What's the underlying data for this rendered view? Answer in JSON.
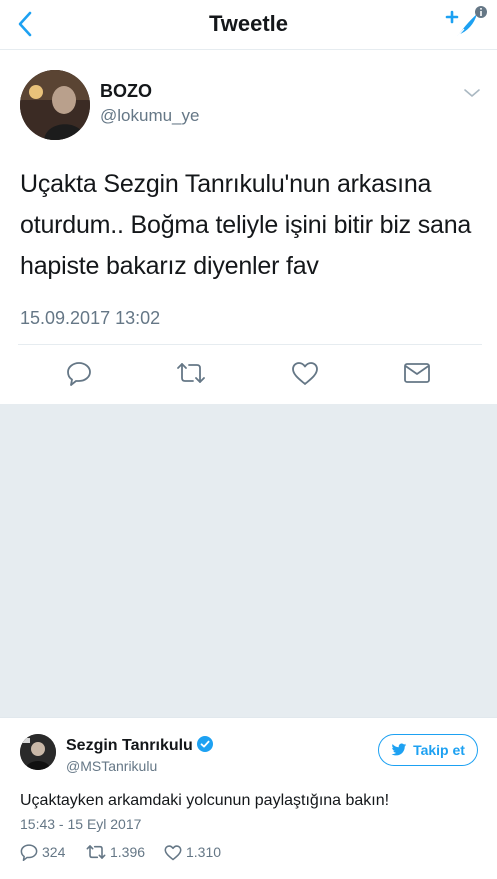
{
  "header": {
    "title": "Tweetle",
    "back_icon": "chevron-left-icon",
    "compose_icon": "compose-feather-icon",
    "accent": "#1da1f2"
  },
  "tweet": {
    "name": "BOZO",
    "handle": "@lokumu_ye",
    "text": "Uçakta Sezgin Tanrıkulu'nun arkasına oturdum.. Boğma teliyle işini bitir biz sana hapiste bakarız diyenler fav",
    "timestamp": "15.09.2017 13:02",
    "actions": [
      "reply-icon",
      "retweet-icon",
      "like-icon",
      "message-icon"
    ]
  },
  "embedded": {
    "name": "Sezgin Tanrıkulu",
    "handle": "@MSTanrikulu",
    "follow_label": "Takip et",
    "text": "Uçaktayken arkamdaki yolcunun paylaştığına bakın!",
    "timestamp": "15:43 - 15 Eyl 2017",
    "replies": "324",
    "retweets": "1.396",
    "likes": "1.310"
  }
}
